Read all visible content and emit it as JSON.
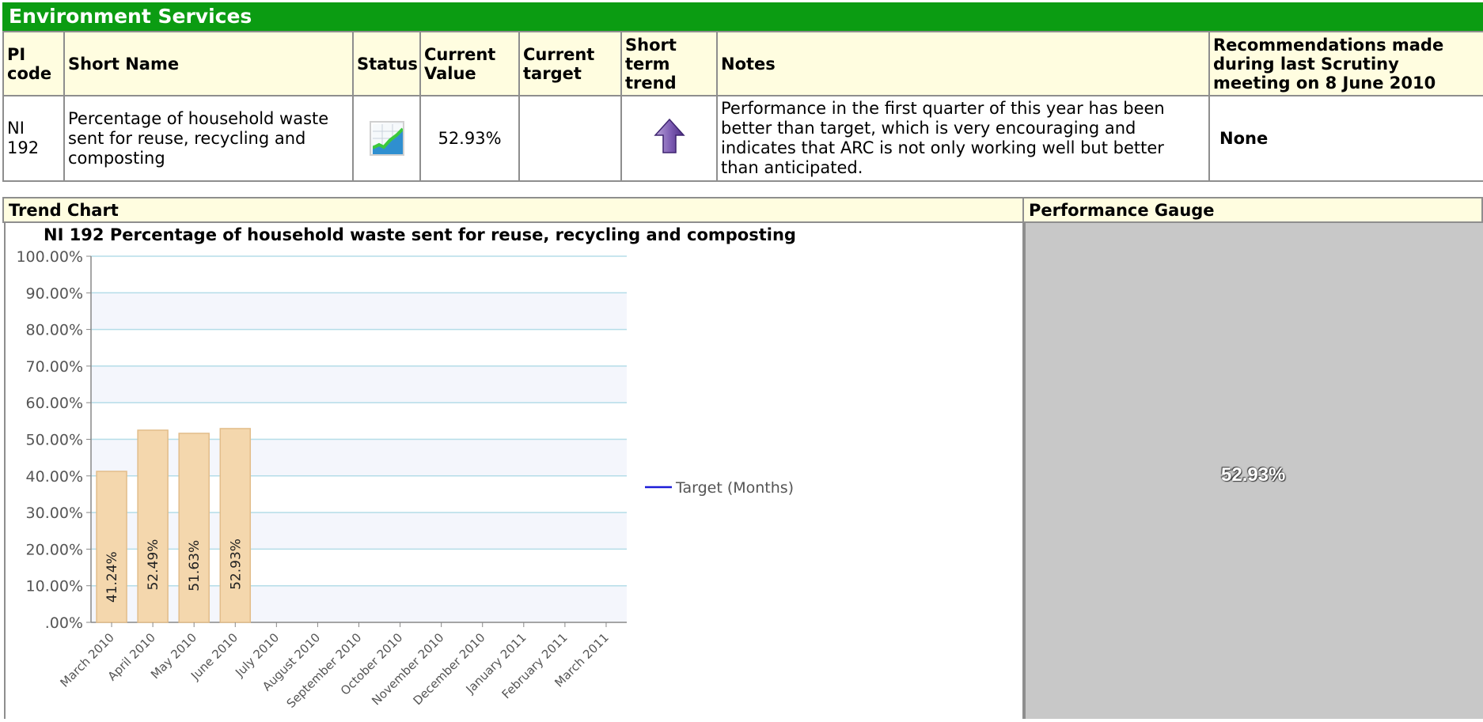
{
  "section": {
    "title": "Environment Services"
  },
  "table": {
    "headers": {
      "pi_code": "PI code",
      "short_name": "Short Name",
      "status": "Status",
      "current_value": "Current Value",
      "current_target": "Current target",
      "short_term_trend": "Short term trend",
      "notes": "Notes",
      "recommendations": "Recommendations made during last Scrutiny meeting on 8 June 2010"
    },
    "row": {
      "pi_code": "NI 192",
      "short_name": "Percentage of household waste sent for reuse, recycling and composting",
      "status_icon": "chart-status-icon",
      "current_value": "52.93%",
      "current_target": "",
      "trend_icon": "up-arrow-icon",
      "notes": "Performance in the first quarter of this year has been better than target, which is very encouraging and indicates that ARC is not only working well but better than anticipated.",
      "recommendations": "None"
    }
  },
  "panels": {
    "trend_chart_label": "Trend Chart",
    "performance_gauge_label": "Performance Gauge",
    "gauge_value": "52.93%"
  },
  "chart_data": {
    "type": "bar",
    "title": "NI 192 Percentage of household waste sent for reuse, recycling and composting",
    "categories": [
      "March 2010",
      "April 2010",
      "May 2010",
      "June 2010",
      "July 2010",
      "August 2010",
      "September 2010",
      "October 2010",
      "November 2010",
      "December 2010",
      "January 2011",
      "February 2011",
      "March 2011"
    ],
    "series": [
      {
        "values": [
          41.24,
          52.49,
          51.63,
          52.93,
          null,
          null,
          null,
          null,
          null,
          null,
          null,
          null,
          null
        ]
      }
    ],
    "data_labels": [
      "41.24%",
      "52.49%",
      "51.63%",
      "52.93%"
    ],
    "legend": [
      "Target (Months)"
    ],
    "yticks": [
      "100.00%",
      "90.00%",
      "80.00%",
      "70.00%",
      "60.00%",
      "50.00%",
      "40.00%",
      "30.00%",
      "20.00%",
      "10.00%",
      ".00%"
    ],
    "ylim": [
      0,
      100
    ],
    "grid": true,
    "colors": {
      "bar_fill": "#f4d7ad",
      "bar_stroke": "#e2bd8a",
      "grid": "#b5dde8",
      "band": "#f4f6fc",
      "legend_line": "#1c1cd8"
    }
  }
}
